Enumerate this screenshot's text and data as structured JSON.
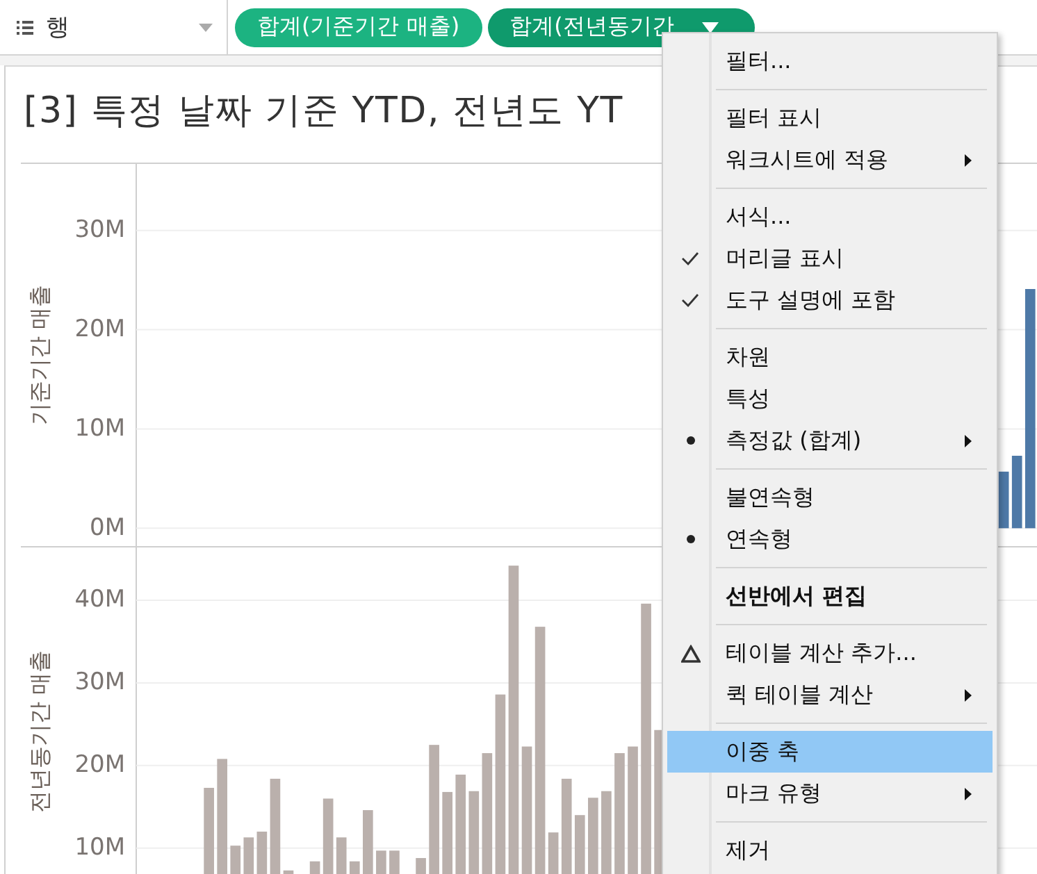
{
  "shelf": {
    "label": "행",
    "pills": [
      {
        "label": "합계(기준기간 매출)",
        "selected": false
      },
      {
        "label": "합계(전년동기간",
        "selected": true
      }
    ]
  },
  "sheet": {
    "title": "[3] 특정 날짜 기준 YTD, 전년도 YT"
  },
  "panes": [
    {
      "chart_data": {
        "type": "bar",
        "ylabel": "기준기간 매출",
        "categories": [
          null,
          null,
          null,
          null,
          null,
          null,
          null,
          null,
          null,
          null,
          null,
          null,
          null,
          null,
          null,
          null,
          null,
          null,
          null,
          null,
          null,
          null,
          null,
          null,
          null,
          null,
          null,
          null,
          null,
          null,
          null,
          null,
          null,
          null,
          null,
          null,
          null,
          null,
          null,
          null,
          null,
          null,
          null,
          null,
          null,
          null,
          null,
          null,
          null,
          null,
          null,
          null,
          null,
          null,
          null,
          null,
          null,
          null,
          null,
          null,
          null,
          null,
          null,
          null,
          null,
          null,
          null,
          null
        ],
        "values": [
          null,
          null,
          null,
          null,
          null,
          null,
          null,
          null,
          null,
          null,
          null,
          null,
          null,
          null,
          null,
          null,
          null,
          null,
          null,
          null,
          null,
          null,
          null,
          null,
          null,
          null,
          null,
          null,
          null,
          null,
          null,
          null,
          null,
          null,
          null,
          null,
          null,
          null,
          null,
          null,
          null,
          null,
          null,
          null,
          null,
          null,
          null,
          null,
          null,
          null,
          null,
          null,
          null,
          null,
          null,
          null,
          null,
          null,
          null,
          null,
          null,
          null,
          null,
          null,
          null,
          5.7,
          7.3,
          24.1
        ],
        "grid": true,
        "ylim": [
          -1.8,
          36.7
        ],
        "yticks": [
          {
            "value": 0,
            "label": "0M"
          },
          {
            "value": 10,
            "label": "10M"
          },
          {
            "value": 20,
            "label": "20M"
          },
          {
            "value": 30,
            "label": "30M"
          }
        ]
      }
    },
    {
      "chart_data": {
        "type": "bar",
        "ylabel": "전년동기간 매출",
        "categories": [
          null,
          null,
          null,
          null,
          null,
          null,
          null,
          null,
          null,
          null,
          null,
          null,
          null,
          null,
          null,
          null,
          null,
          null,
          null,
          null,
          null,
          null,
          null,
          null,
          null,
          null,
          null,
          null,
          null,
          null,
          null,
          null,
          null,
          null,
          null,
          null,
          null,
          null,
          null,
          null,
          null,
          null,
          null,
          null,
          null,
          null,
          null,
          null,
          null,
          null,
          null,
          null,
          null,
          null,
          null,
          null,
          null,
          null,
          null,
          null,
          null,
          null,
          null,
          null,
          null,
          null,
          null,
          null
        ],
        "values": [
          null,
          null,
          null,
          null,
          null,
          17.3,
          20.8,
          10.3,
          11.3,
          12.0,
          18.4,
          7.3,
          null,
          8.4,
          16.0,
          11.3,
          8.4,
          14.6,
          9.7,
          9.7,
          null,
          8.8,
          22.5,
          16.8,
          18.9,
          16.9,
          21.5,
          28.6,
          44.2,
          22.3,
          36.8,
          11.9,
          18.4,
          14.0,
          16.1,
          16.9,
          21.5,
          22.3,
          39.6,
          24.3,
          null,
          null,
          null,
          null,
          null,
          null,
          null,
          null,
          null,
          null,
          null,
          null,
          null,
          null,
          null,
          null,
          null,
          null,
          null,
          null,
          null,
          null,
          null,
          null,
          null,
          null,
          null,
          null
        ],
        "grid": true,
        "ylim": [
          6.7,
          46.4
        ],
        "yticks": [
          {
            "value": 10,
            "label": "10M"
          },
          {
            "value": 20,
            "label": "20M"
          },
          {
            "value": 30,
            "label": "30M"
          },
          {
            "value": 40,
            "label": "40M"
          }
        ]
      }
    }
  ],
  "menu": {
    "groups": [
      [
        {
          "label": "필터...",
          "kind": "plain",
          "submenu": false,
          "emphasized": false,
          "selected": false
        }
      ],
      [
        {
          "label": "필터 표시",
          "kind": "plain",
          "submenu": false,
          "emphasized": false,
          "selected": false
        },
        {
          "label": "워크시트에 적용",
          "kind": "plain",
          "submenu": true,
          "emphasized": false,
          "selected": false
        }
      ],
      [
        {
          "label": "서식...",
          "kind": "plain",
          "submenu": false,
          "emphasized": false,
          "selected": false
        },
        {
          "label": "머리글 표시",
          "kind": "check",
          "checked": true,
          "submenu": false,
          "emphasized": false,
          "selected": false
        },
        {
          "label": "도구 설명에 포함",
          "kind": "check",
          "checked": true,
          "submenu": false,
          "emphasized": false,
          "selected": false
        }
      ],
      [
        {
          "label": "차원",
          "kind": "radio",
          "checked": false,
          "submenu": false,
          "emphasized": false,
          "selected": false
        },
        {
          "label": "특성",
          "kind": "radio",
          "checked": false,
          "submenu": false,
          "emphasized": false,
          "selected": false
        },
        {
          "label": "측정값 (합계)",
          "kind": "radio",
          "checked": true,
          "submenu": true,
          "emphasized": false,
          "selected": false
        }
      ],
      [
        {
          "label": "불연속형",
          "kind": "radio",
          "checked": false,
          "submenu": false,
          "emphasized": false,
          "selected": false
        },
        {
          "label": "연속형",
          "kind": "radio",
          "checked": true,
          "submenu": false,
          "emphasized": false,
          "selected": false
        }
      ],
      [
        {
          "label": "선반에서 편집",
          "kind": "plain",
          "submenu": false,
          "emphasized": true,
          "selected": false
        }
      ],
      [
        {
          "label": "테이블 계산 추가...",
          "kind": "calc",
          "submenu": false,
          "emphasized": false,
          "selected": false
        },
        {
          "label": "퀵 테이블 계산",
          "kind": "plain",
          "submenu": true,
          "emphasized": false,
          "selected": false
        }
      ],
      [
        {
          "label": "이중 축",
          "kind": "plain",
          "submenu": false,
          "emphasized": false,
          "selected": true
        },
        {
          "label": "마크 유형",
          "kind": "plain",
          "submenu": true,
          "emphasized": false,
          "selected": false
        }
      ],
      [
        {
          "label": "제거",
          "kind": "plain",
          "submenu": false,
          "emphasized": false,
          "selected": false
        }
      ]
    ]
  }
}
